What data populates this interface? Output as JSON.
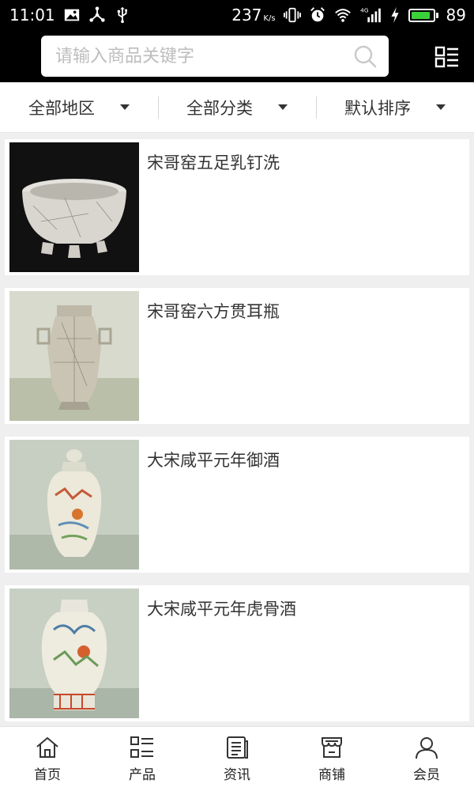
{
  "status_bar": {
    "time": "11:01",
    "net_speed": "237",
    "net_unit": "K/s",
    "network_type": "4G",
    "battery": "89",
    "battery_level": 0.89,
    "left_icons": [
      "image-icon",
      "usb-tether-icon",
      "usb-icon"
    ],
    "right_icons": [
      "vibrate-icon",
      "alarm-icon",
      "wifi-icon",
      "signal-icon",
      "charging-icon"
    ]
  },
  "header": {
    "search_placeholder": "请输入商品关键字",
    "search_icon": "search-icon",
    "menu_icon": "grid-menu-icon"
  },
  "filters": [
    {
      "label": "全部地区",
      "icon": "caret-down-icon"
    },
    {
      "label": "全部分类",
      "icon": "caret-down-icon"
    },
    {
      "label": "默认排序",
      "icon": "caret-down-icon"
    }
  ],
  "products": [
    {
      "title": "宋哥窑五足乳钉洗",
      "image": "crackle-glaze-bowl"
    },
    {
      "title": "宋哥窑六方贯耳瓶",
      "image": "crackle-glaze-vase"
    },
    {
      "title": "大宋咸平元年御酒",
      "image": "painted-wine-jar"
    },
    {
      "title": "大宋咸平元年虎骨酒",
      "image": "painted-wine-jar-2"
    }
  ],
  "bottom_nav": [
    {
      "label": "首页",
      "icon": "home-icon"
    },
    {
      "label": "产品",
      "icon": "product-list-icon"
    },
    {
      "label": "资讯",
      "icon": "news-icon"
    },
    {
      "label": "商铺",
      "icon": "store-icon"
    },
    {
      "label": "会员",
      "icon": "user-icon"
    }
  ],
  "colors": {
    "status_bg": "#000000",
    "header_bg": "#000000",
    "page_bg": "#efefef",
    "battery_fill": "#3ad13a",
    "text": "#333333"
  }
}
